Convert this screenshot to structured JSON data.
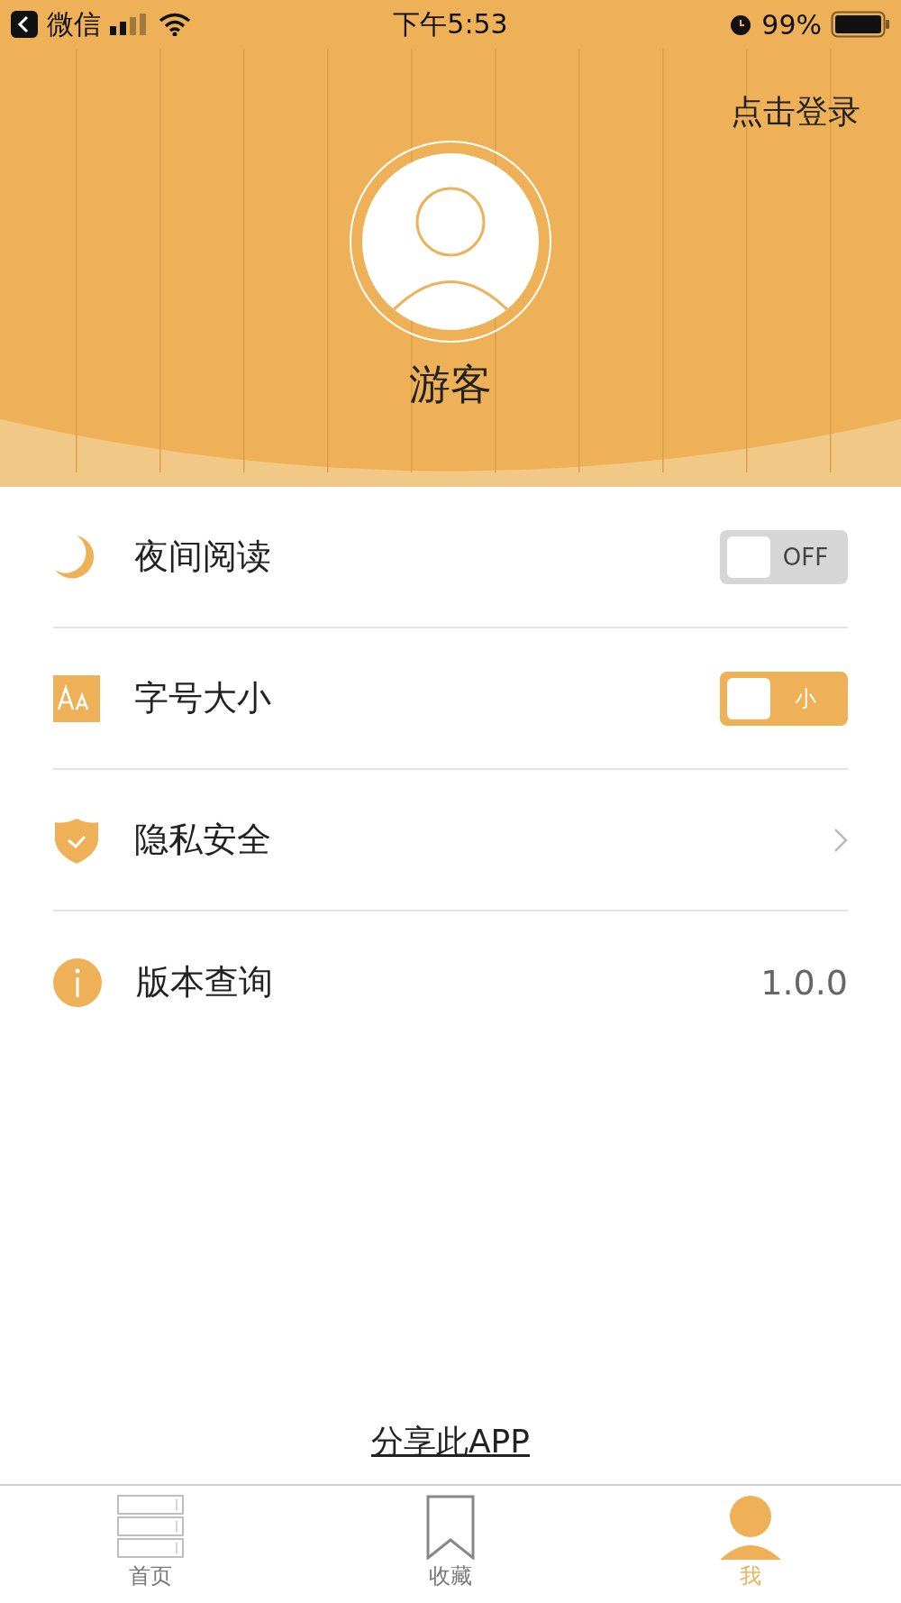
{
  "status_bar": {
    "back_app": "微信",
    "time": "下午5:53",
    "battery": "99%"
  },
  "header": {
    "login": "点击登录",
    "username": "游客"
  },
  "settings": [
    {
      "kind": "toggle",
      "label": "夜间阅读",
      "toggle_text": "OFF",
      "on": false
    },
    {
      "kind": "toggle",
      "label": "字号大小",
      "toggle_text": "小",
      "on": true
    },
    {
      "kind": "chevron",
      "label": "隐私安全"
    },
    {
      "kind": "value",
      "label": "版本查询",
      "value": "1.0.0"
    }
  ],
  "share_link": "分享此APP",
  "tabs": [
    {
      "label": "首页",
      "selected": false
    },
    {
      "label": "收藏",
      "selected": false
    },
    {
      "label": "我",
      "selected": true
    }
  ]
}
